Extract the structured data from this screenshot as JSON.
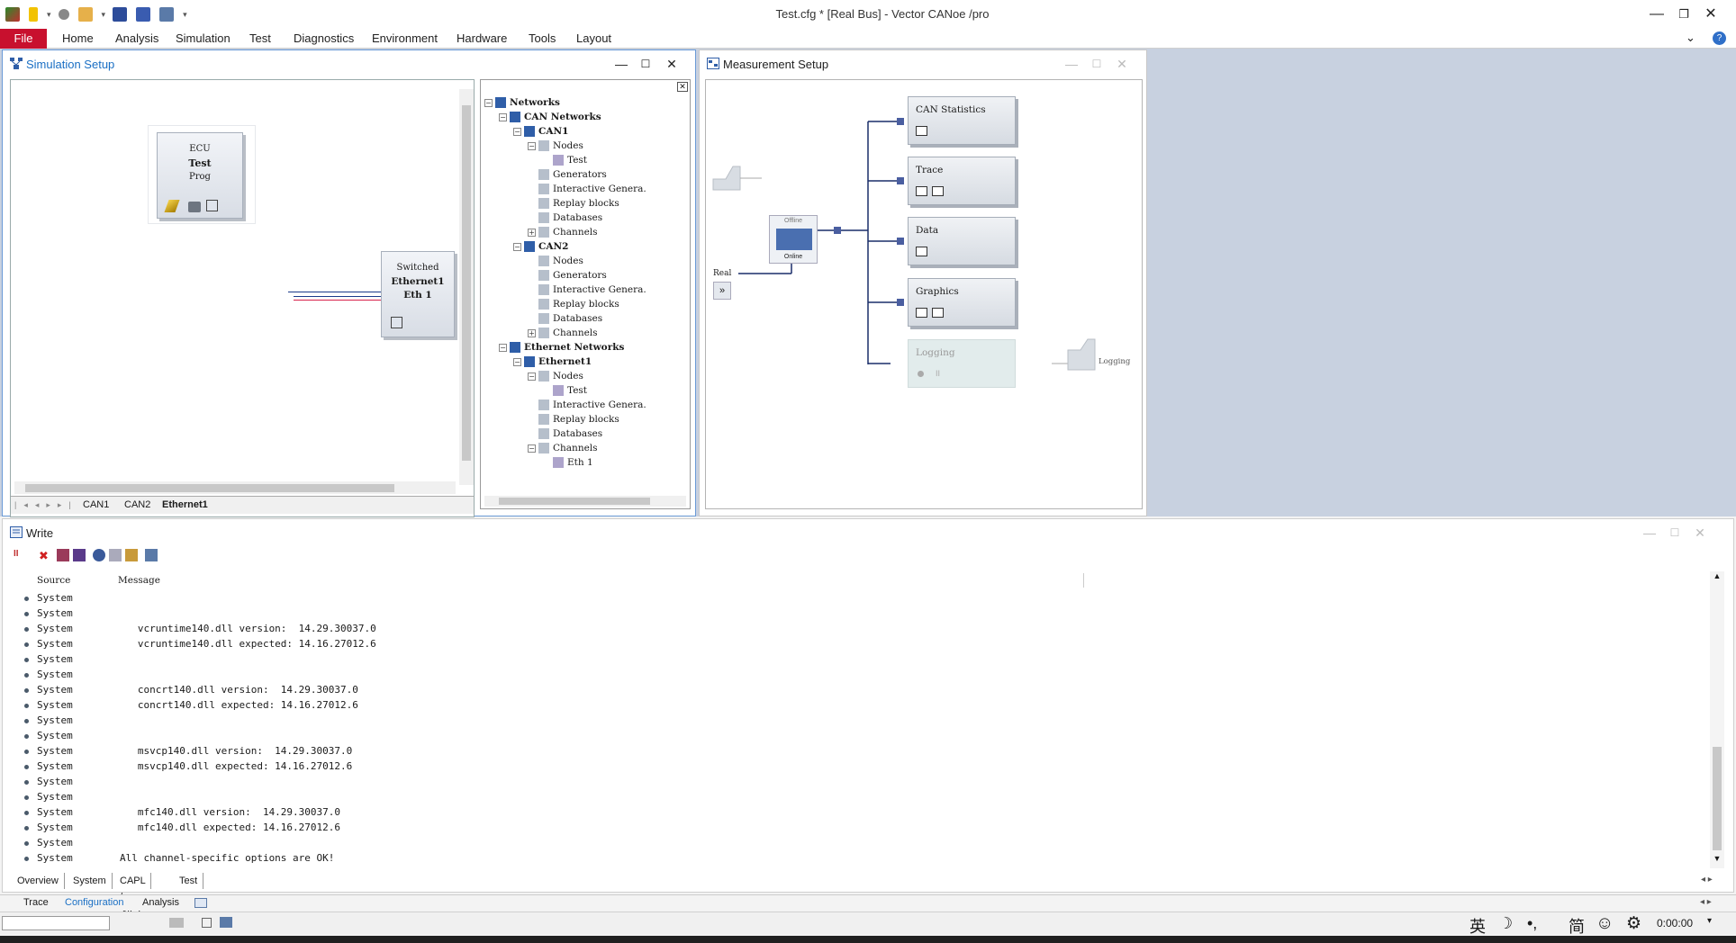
{
  "app": {
    "title": "Test.cfg * [Real Bus] - Vector CANoe /pro"
  },
  "menu": {
    "file": "File",
    "items": [
      "Home",
      "Analysis",
      "Simulation",
      "Test",
      "Diagnostics",
      "Environment",
      "Hardware",
      "Tools",
      "Layout"
    ]
  },
  "simulation_setup": {
    "title": "Simulation Setup",
    "ecu_node": {
      "line1": "ECU",
      "line2": "Test",
      "line3": "Prog"
    },
    "switch_node": {
      "line1": "Switched",
      "line2": "Ethernet1",
      "line3": "Eth 1"
    },
    "bus_tabs": [
      "CAN1",
      "CAN2",
      "Ethernet1"
    ],
    "tree": [
      {
        "label": "Networks",
        "depth": 0,
        "exp": "−",
        "bold": true
      },
      {
        "label": "CAN Networks",
        "depth": 1,
        "exp": "−",
        "bold": true
      },
      {
        "label": "CAN1",
        "depth": 2,
        "exp": "−",
        "bold": true
      },
      {
        "label": "Nodes",
        "depth": 3,
        "exp": "−",
        "bold": false
      },
      {
        "label": "Test",
        "depth": 4,
        "exp": "",
        "bold": false
      },
      {
        "label": "Generators",
        "depth": 3,
        "exp": "",
        "bold": false
      },
      {
        "label": "Interactive Genera.",
        "depth": 3,
        "exp": "",
        "bold": false
      },
      {
        "label": "Replay blocks",
        "depth": 3,
        "exp": "",
        "bold": false
      },
      {
        "label": "Databases",
        "depth": 3,
        "exp": "",
        "bold": false
      },
      {
        "label": "Channels",
        "depth": 3,
        "exp": "+",
        "bold": false
      },
      {
        "label": "CAN2",
        "depth": 2,
        "exp": "−",
        "bold": true
      },
      {
        "label": "Nodes",
        "depth": 3,
        "exp": "",
        "bold": false
      },
      {
        "label": "Generators",
        "depth": 3,
        "exp": "",
        "bold": false
      },
      {
        "label": "Interactive Genera.",
        "depth": 3,
        "exp": "",
        "bold": false
      },
      {
        "label": "Replay blocks",
        "depth": 3,
        "exp": "",
        "bold": false
      },
      {
        "label": "Databases",
        "depth": 3,
        "exp": "",
        "bold": false
      },
      {
        "label": "Channels",
        "depth": 3,
        "exp": "+",
        "bold": false
      },
      {
        "label": "Ethernet Networks",
        "depth": 1,
        "exp": "−",
        "bold": true
      },
      {
        "label": "Ethernet1",
        "depth": 2,
        "exp": "−",
        "bold": true
      },
      {
        "label": "Nodes",
        "depth": 3,
        "exp": "−",
        "bold": false
      },
      {
        "label": "Test",
        "depth": 4,
        "exp": "",
        "bold": false
      },
      {
        "label": "Interactive Genera.",
        "depth": 3,
        "exp": "",
        "bold": false
      },
      {
        "label": "Replay blocks",
        "depth": 3,
        "exp": "",
        "bold": false
      },
      {
        "label": "Databases",
        "depth": 3,
        "exp": "",
        "bold": false
      },
      {
        "label": "Channels",
        "depth": 3,
        "exp": "−",
        "bold": false
      },
      {
        "label": "Eth 1",
        "depth": 4,
        "exp": "",
        "bold": false
      }
    ]
  },
  "measurement_setup": {
    "title": "Measurement Setup",
    "real_label": "Real",
    "offline_label": "Offline",
    "online_label": "Online",
    "logging_label": "Logging",
    "blocks": [
      "CAN Statistics",
      "Trace",
      "Data",
      "Graphics",
      "Logging"
    ]
  },
  "write": {
    "title": "Write",
    "col_source": "Source",
    "col_message": "Message",
    "rows": [
      {
        "source": "System",
        "message": ""
      },
      {
        "source": "System",
        "message": ""
      },
      {
        "source": "System",
        "message": "   vcruntime140.dll version:  14.29.30037.0"
      },
      {
        "source": "System",
        "message": "   vcruntime140.dll expected: 14.16.27012.6"
      },
      {
        "source": "System",
        "message": ""
      },
      {
        "source": "System",
        "message": ""
      },
      {
        "source": "System",
        "message": "   concrt140.dll version:  14.29.30037.0"
      },
      {
        "source": "System",
        "message": "   concrt140.dll expected: 14.16.27012.6"
      },
      {
        "source": "System",
        "message": ""
      },
      {
        "source": "System",
        "message": ""
      },
      {
        "source": "System",
        "message": "   msvcp140.dll version:  14.29.30037.0"
      },
      {
        "source": "System",
        "message": "   msvcp140.dll expected: 14.16.27012.6"
      },
      {
        "source": "System",
        "message": ""
      },
      {
        "source": "System",
        "message": ""
      },
      {
        "source": "System",
        "message": "   mfc140.dll version:  14.29.30037.0"
      },
      {
        "source": "System",
        "message": "   mfc140.dll expected: 14.16.27012.6"
      },
      {
        "source": "System",
        "message": ""
      },
      {
        "source": "System",
        "message": "All channel-specific options are OK!"
      }
    ],
    "tabs": [
      "Overview",
      "System",
      "CAPL / .NET",
      "Test"
    ]
  },
  "bottom_tabs": [
    "Trace",
    "Configuration",
    "Analysis"
  ],
  "status": {
    "time": "0:00:00",
    "ime": [
      "英",
      "简"
    ]
  }
}
